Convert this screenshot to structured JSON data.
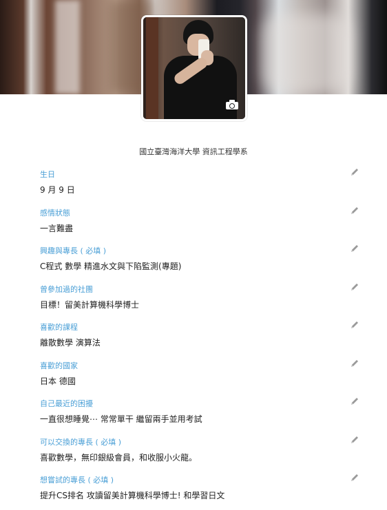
{
  "profile": {
    "school": "國立臺灣海洋大學 資訊工程學系",
    "icons": {
      "camera": "camera-icon",
      "edit": "pencil-icon"
    }
  },
  "fields": [
    {
      "label": "生日",
      "value": "9 月 9 日"
    },
    {
      "label": "感情狀態",
      "value": "一言難盡"
    },
    {
      "label": "興趣與專長 ( 必填 )",
      "value": "C程式 數學 精進水文與下陷監測(專題)"
    },
    {
      "label": "曾參加過的社團",
      "value": "目標！留美計算機科學博士"
    },
    {
      "label": "喜歡的課程",
      "value": "離散數學 演算法"
    },
    {
      "label": "喜歡的國家",
      "value": "日本 德國"
    },
    {
      "label": "自己最近的困擾",
      "value": "一直很想睡覺⋯ 常常單干 繼留兩手並用考試"
    },
    {
      "label": "可以交換的專長 ( 必填 )",
      "value": "喜歡數學，無印銀級會員，和收服小火龍。"
    },
    {
      "label": "想嘗試的專長 ( 必填 )",
      "value": "提升CS排名 攻讀留美計算機科學博士! 和學習日文"
    }
  ],
  "colors": {
    "label": "#4a9fd6",
    "value": "#222222",
    "icon": "#9a9a9a"
  }
}
